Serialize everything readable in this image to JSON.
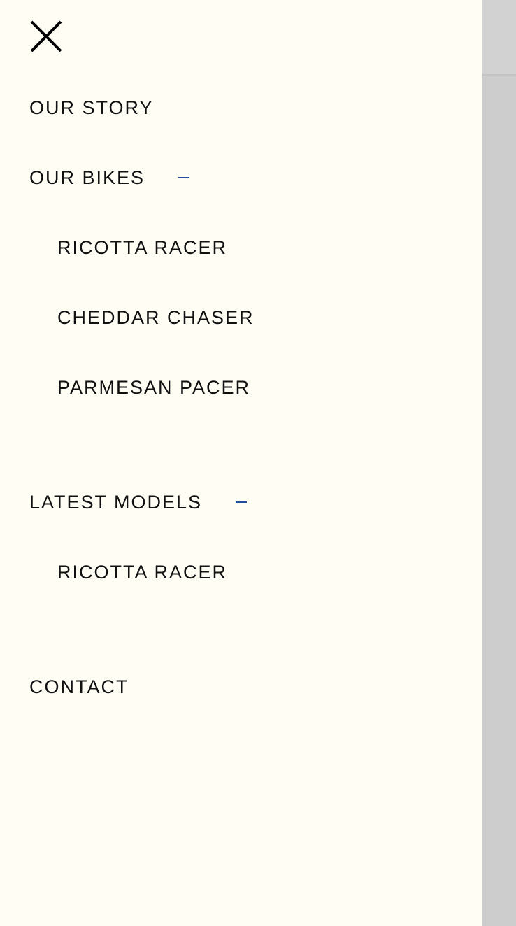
{
  "menu": {
    "close_icon": "close-icon",
    "accent_color": "#1f4f9e",
    "items": {
      "our_story": "OUR STORY",
      "our_bikes": "OUR BIKES",
      "latest_models": "LATEST MODELS",
      "contact": "CONTACT"
    },
    "our_bikes_children": [
      "RICOTTA RACER",
      "CHEDDAR CHASER",
      "PARMESAN PACER"
    ],
    "latest_models_children": [
      "RICOTTA RACER"
    ],
    "expanded_sections": [
      "OUR BIKES",
      "LATEST MODELS"
    ]
  }
}
